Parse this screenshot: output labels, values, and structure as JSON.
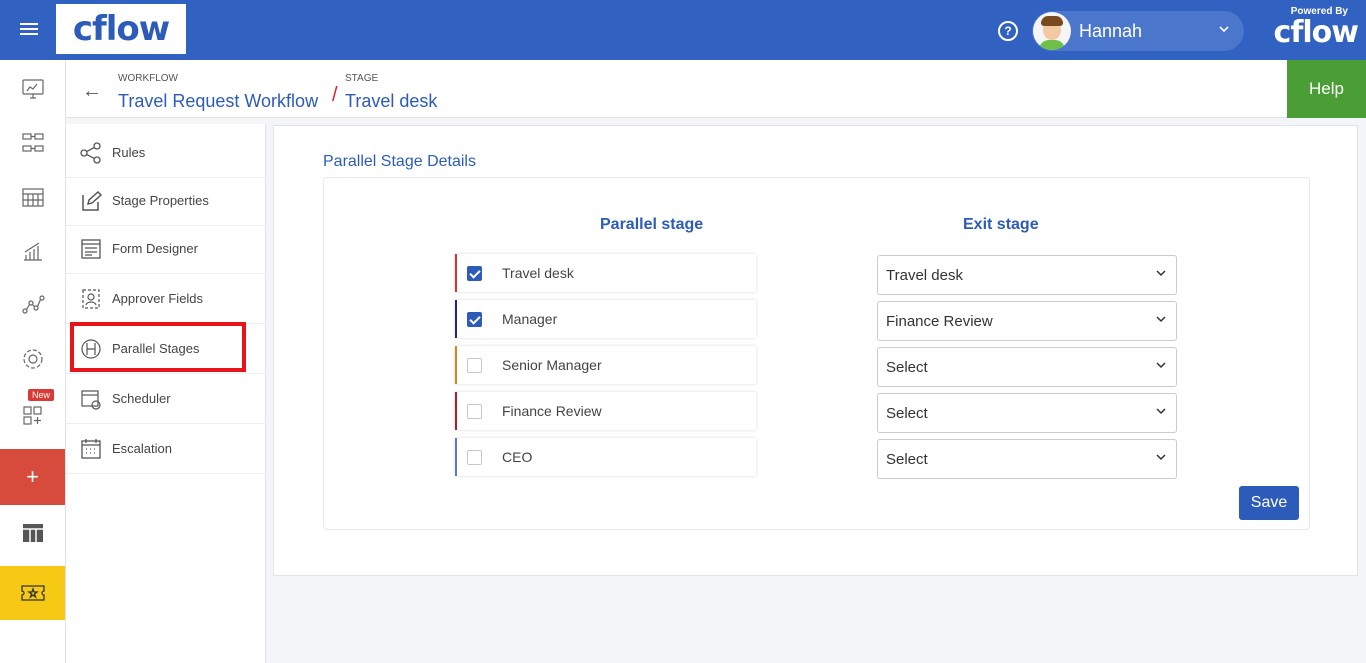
{
  "app": {
    "logo_text": "cflow",
    "powered_by": "Powered By",
    "powered_logo": "cflow"
  },
  "header": {
    "help_icon_glyph": "?",
    "user_name": "Hannah",
    "help_label": "Help"
  },
  "breadcrumb": {
    "workflow_label": "WORKFLOW",
    "workflow_name": "Travel Request Workflow",
    "separator": "/",
    "stage_label": "STAGE",
    "stage_name": "Travel desk"
  },
  "rail": {
    "new_badge": "New",
    "plus_glyph": "+"
  },
  "subnav": {
    "items": [
      {
        "label": "Rules",
        "icon": "share-icon"
      },
      {
        "label": "Stage Properties",
        "icon": "edit-icon"
      },
      {
        "label": "Form Designer",
        "icon": "form-icon"
      },
      {
        "label": "Approver Fields",
        "icon": "approver-icon"
      },
      {
        "label": "Parallel Stages",
        "icon": "parallel-icon"
      },
      {
        "label": "Scheduler",
        "icon": "calendar-gear-icon"
      },
      {
        "label": "Escalation",
        "icon": "calendar-icon"
      }
    ]
  },
  "main": {
    "title": "Parallel Stage Details",
    "col_parallel": "Parallel stage",
    "col_exit": "Exit stage",
    "rows": [
      {
        "stage": "Travel desk",
        "checked": true,
        "color": "#d9342b",
        "exit": "Travel desk"
      },
      {
        "stage": "Manager",
        "checked": true,
        "color": "#1e2a78",
        "exit": "Finance Review"
      },
      {
        "stage": "Senior Manager",
        "checked": false,
        "color": "#d08a1c",
        "exit": "Select"
      },
      {
        "stage": "Finance Review",
        "checked": false,
        "color": "#b01e2a",
        "exit": "Select"
      },
      {
        "stage": "CEO",
        "checked": false,
        "color": "#5a7fb0",
        "exit": "Select"
      }
    ],
    "save_label": "Save"
  },
  "colors": {
    "topbar": "#3162c2",
    "accent": "#2d5bb9",
    "help": "#4a9e35",
    "plus": "#d64b3c",
    "ticket": "#f6c915"
  }
}
